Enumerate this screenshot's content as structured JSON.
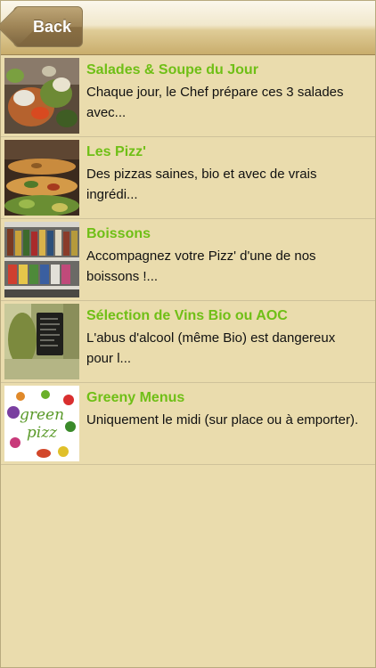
{
  "header": {
    "back_label": "Back"
  },
  "items": [
    {
      "title": "Salades & Soupe du Jour",
      "description": "Chaque jour, le Chef prépare ces 3 salades avec..."
    },
    {
      "title": "Les Pizz'",
      "description": "Des pizzas saines, bio et avec de vrais ingrédi..."
    },
    {
      "title": "Boissons",
      "description": "Accompagnez votre Pizz' d'une de nos boissons !..."
    },
    {
      "title": "Sélection de Vins Bio ou AOC",
      "description": "L'abus d'alcool (même Bio) est dangereux pour l..."
    },
    {
      "title": "Greeny Menus",
      "description": "Uniquement le midi (sur place ou à emporter).",
      "thumb_logo": "green pizz"
    }
  ],
  "colors": {
    "background": "#eadcad",
    "title_green": "#6fbf16",
    "header_gold": "#c9ad6c"
  }
}
